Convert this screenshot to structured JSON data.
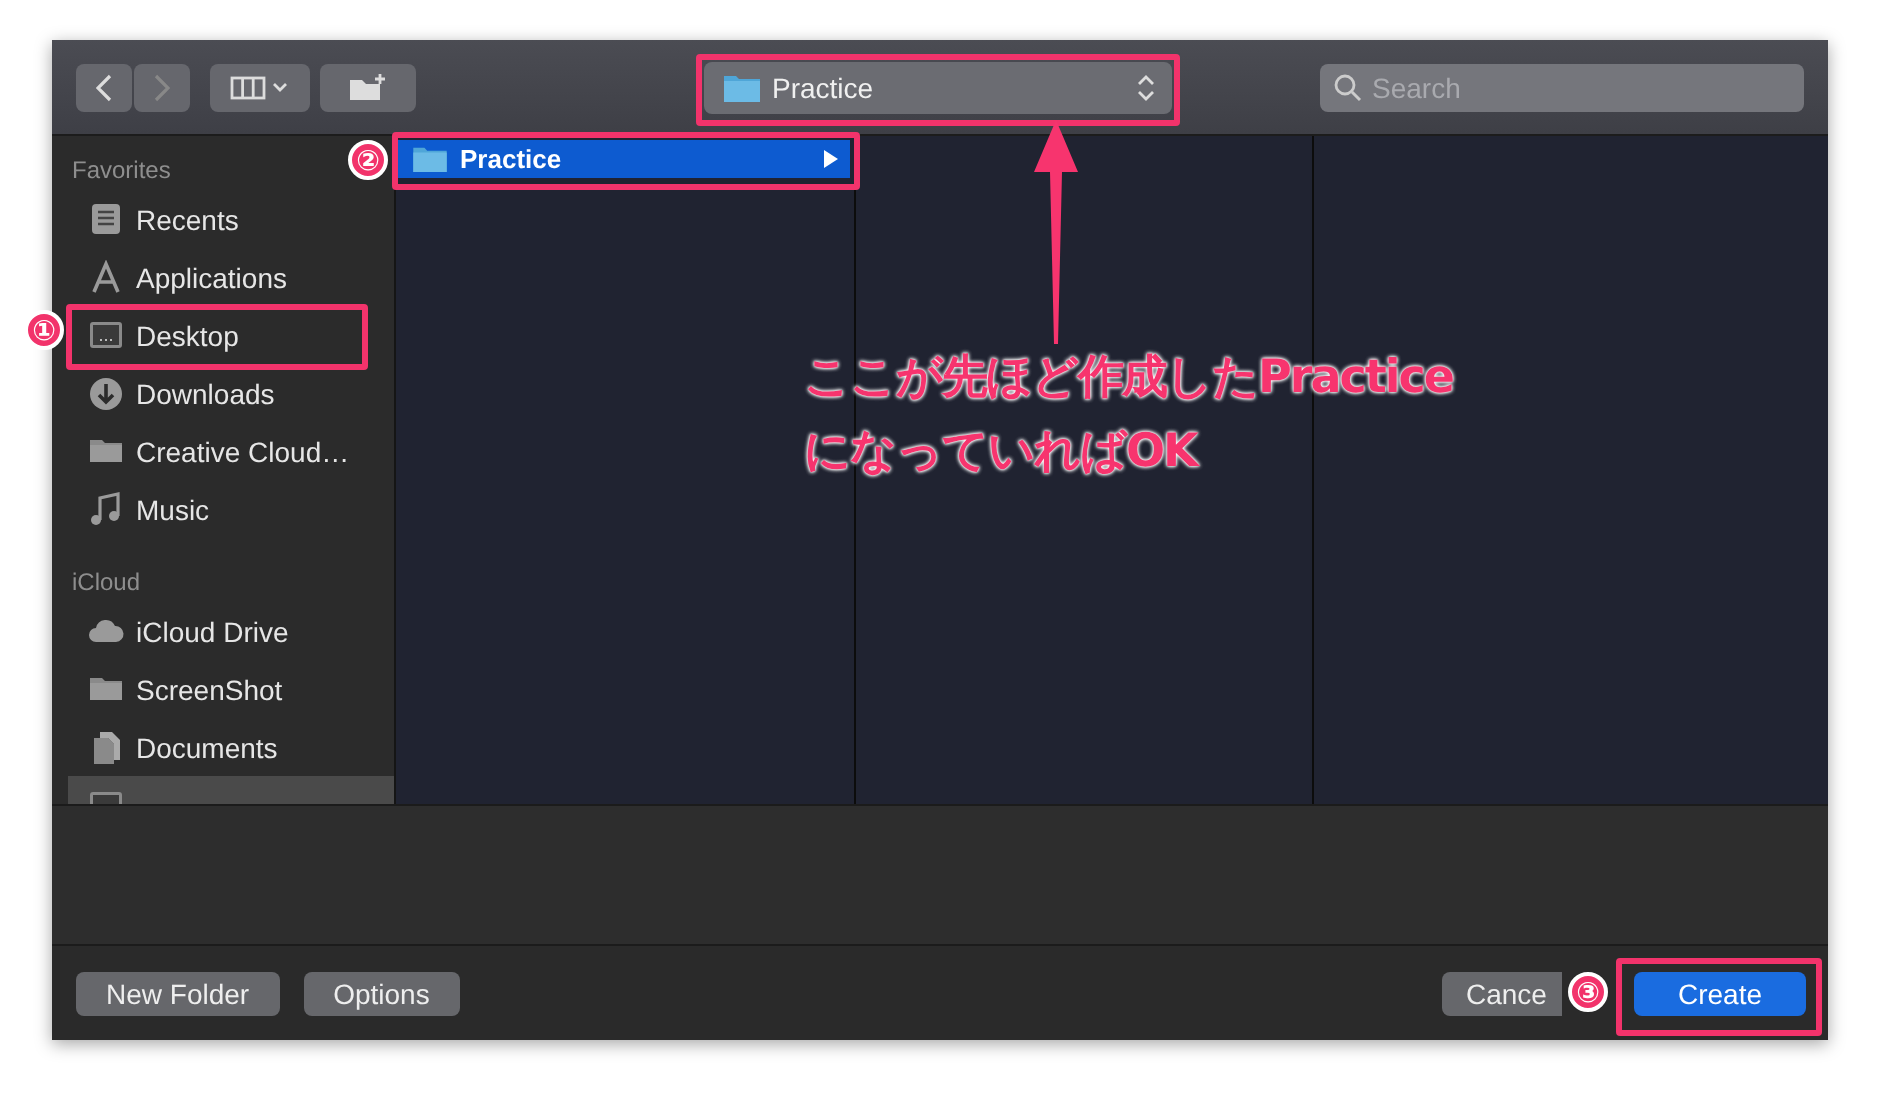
{
  "toolbar": {
    "path_popup": {
      "label": "Practice"
    },
    "search": {
      "placeholder": "Search"
    }
  },
  "sidebar": {
    "sections": [
      {
        "heading": "Favorites",
        "items": [
          {
            "label": "Recents",
            "kind": "recents",
            "selected": false
          },
          {
            "label": "Applications",
            "kind": "apps",
            "selected": false
          },
          {
            "label": "Desktop",
            "kind": "desktop",
            "selected": false
          },
          {
            "label": "Downloads",
            "kind": "downloads",
            "selected": false
          },
          {
            "label": "Creative Cloud…",
            "kind": "folder",
            "selected": false
          },
          {
            "label": "Music",
            "kind": "music",
            "selected": false
          }
        ]
      },
      {
        "heading": "iCloud",
        "items": [
          {
            "label": "iCloud Drive",
            "kind": "cloud",
            "selected": false
          },
          {
            "label": "ScreenShot",
            "kind": "folder",
            "selected": false
          },
          {
            "label": "Documents",
            "kind": "documents",
            "selected": false
          },
          {
            "kind": "desktop",
            "selected": true
          }
        ]
      }
    ]
  },
  "columns": [
    {
      "items": [
        {
          "label": "Practice",
          "selected": true
        }
      ]
    }
  ],
  "buttons": {
    "left": [
      {
        "label": "New Folder"
      },
      {
        "label": "Options"
      }
    ],
    "right": [
      {
        "label": "Cance",
        "kind": "secondary"
      },
      {
        "label": "Create",
        "kind": "primary"
      }
    ]
  },
  "annotations": {
    "markers": [
      "①",
      "②",
      "③"
    ],
    "note": [
      "ここが先ほど作成したPractice",
      "になっていればOK"
    ]
  }
}
